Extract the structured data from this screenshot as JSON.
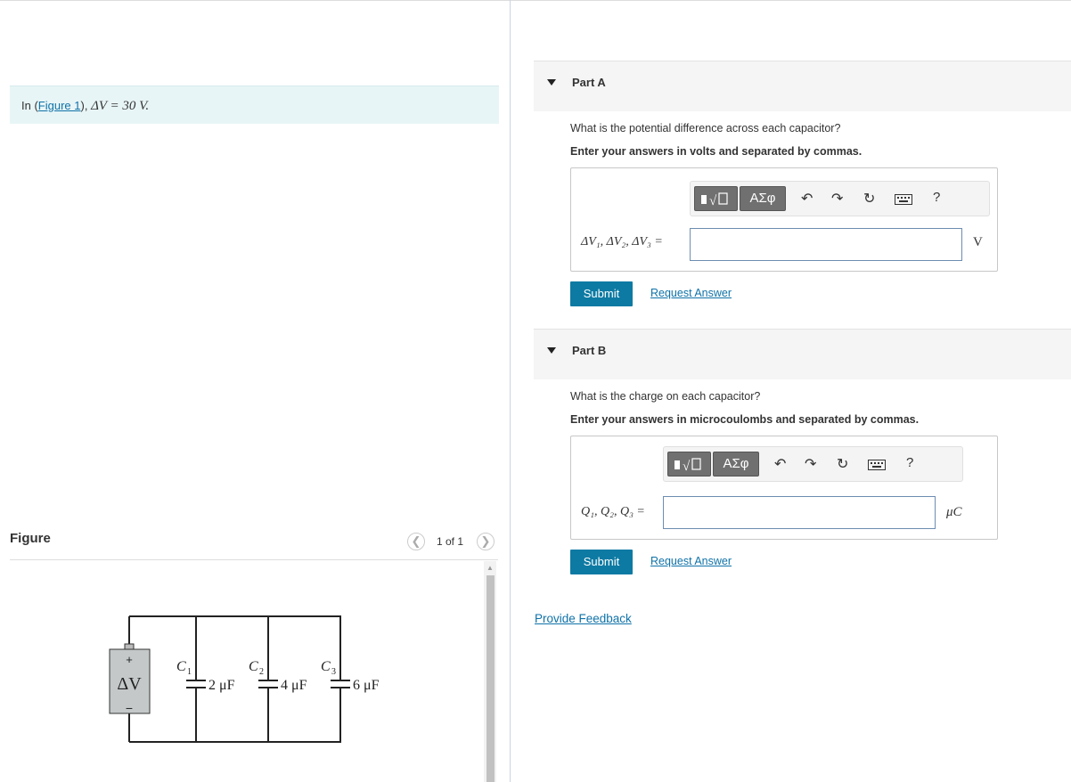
{
  "intro": {
    "prefix": "In (",
    "figure_link": "Figure 1",
    "suffix": "), ",
    "formula": "ΔV = 30 V."
  },
  "figure": {
    "label": "Figure",
    "pager": "1 of 1",
    "circuit": {
      "source_plus": "+",
      "source_minus": "−",
      "source_label": "ΔV",
      "c1_label": "C",
      "c1_sub": "1",
      "c1_value": "2 μF",
      "c2_label": "C",
      "c2_sub": "2",
      "c2_value": "4 μF",
      "c3_label": "C",
      "c3_sub": "3",
      "c3_value": "6 μF"
    }
  },
  "partA": {
    "title": "Part A",
    "question": "What is the potential difference across each capacitor?",
    "instruction": "Enter your answers in volts and separated by commas.",
    "label": "ΔV₁, ΔV₂, ΔV₃ =",
    "value": "",
    "unit": "V",
    "submit": "Submit",
    "request": "Request Answer"
  },
  "partB": {
    "title": "Part B",
    "question": "What is the charge on each capacitor?",
    "instruction": "Enter your answers in microcoulombs and separated by commas.",
    "label": "Q₁, Q₂, Q₃ =",
    "value": "",
    "unit": "μC",
    "submit": "Submit",
    "request": "Request Answer"
  },
  "toolbar": {
    "greek": "ΑΣφ",
    "help": "?"
  },
  "feedback": "Provide Feedback",
  "icons": [
    "chevron-left-icon",
    "chevron-right-icon",
    "collapse-triangle-icon",
    "template-icon",
    "undo-icon",
    "redo-icon",
    "reset-icon",
    "keyboard-icon",
    "help-icon"
  ]
}
